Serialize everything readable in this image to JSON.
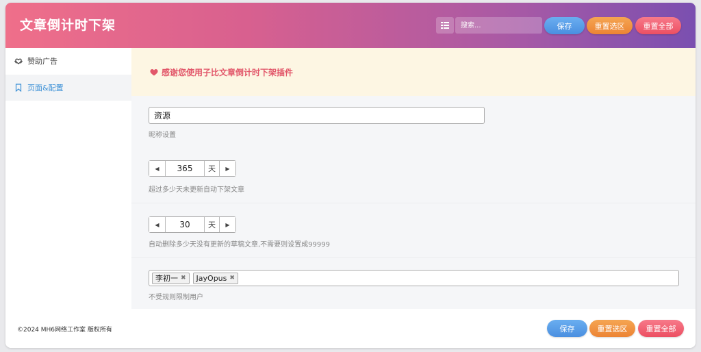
{
  "header": {
    "title": "文章倒计时下架",
    "search_placeholder": "搜索...",
    "save_label": "保存",
    "reset_section_label": "重置选区",
    "reset_all_label": "重置全部"
  },
  "sidebar": {
    "items": [
      {
        "label": "赞助广告",
        "icon": "heart-hands-icon",
        "active": false
      },
      {
        "label": "页面&配置",
        "icon": "bookmark-icon",
        "active": true
      }
    ]
  },
  "main": {
    "notice": "感谢您使用子比文章倒计时下架插件",
    "nickname": {
      "value": "资源",
      "hint": "昵称设置"
    },
    "expire_days": {
      "value": "365",
      "unit": "天",
      "hint": "超过多少天未更新自动下架文章"
    },
    "draft_days": {
      "value": "30",
      "unit": "天",
      "hint": "自动删除多少天没有更新的草稿文章,不需要则设置成99999"
    },
    "exempt_users": {
      "tags": [
        "李初一",
        "JayOpus"
      ],
      "hint": "不受规则限制用户"
    }
  },
  "footer": {
    "copyright": "©2024 MH6网络工作室 版权所有",
    "save_label": "保存",
    "reset_section_label": "重置选区",
    "reset_all_label": "重置全部"
  },
  "colors": {
    "accent_blue": "#4a8fe0",
    "accent_orange": "#ec8434",
    "accent_red": "#ec4f62",
    "notice_text": "#e2576a",
    "active_link": "#3a8fd6"
  }
}
